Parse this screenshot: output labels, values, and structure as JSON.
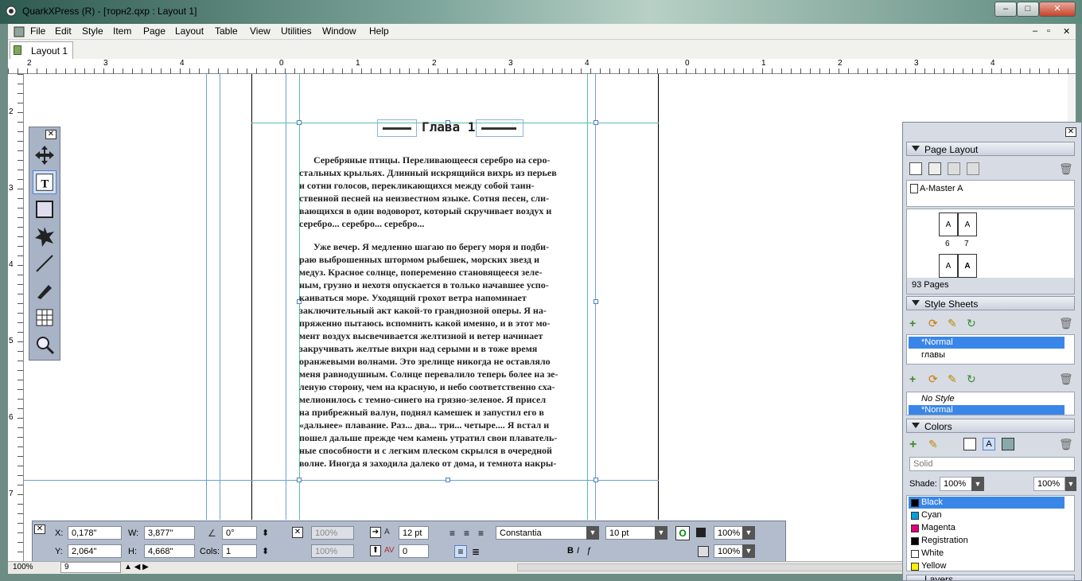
{
  "window": {
    "title": "QuarkXPress (R) - [торн2.qxp : Layout 1]",
    "controls": [
      "–",
      "□",
      "✕"
    ],
    "doc_controls": [
      "–",
      "▫",
      "✕"
    ]
  },
  "menu": [
    "File",
    "Edit",
    "Style",
    "Item",
    "Page",
    "Layout",
    "Table",
    "View",
    "Utilities",
    "Window",
    "Help"
  ],
  "tab": {
    "label": "Layout 1"
  },
  "ruler": {
    "h_ticks": [
      "2",
      "3",
      "4",
      "0",
      "1",
      "2",
      "3",
      "4",
      "0",
      "1",
      "2",
      "3",
      "4"
    ],
    "v_ticks": [
      "2",
      "3",
      "4",
      "5",
      "6",
      "7"
    ]
  },
  "document": {
    "heading": "Глава 1",
    "paragraph1": [
      "Серебряные птицы. Переливающееся серебро на серо-",
      "стальных крыльях. Длинный искрящийся вихрь из перьев",
      "и сотни голосов, перекликающихся между собой таин-",
      "ственной песней на неизвестном языке. Сотня песен, сли-",
      "вающихся в один водоворот, который скручивает воздух и",
      "серебро... серебро... серебро..."
    ],
    "paragraph2": [
      "Уже вечер. Я медленно шагаю по берегу моря и подби-",
      "раю выброшенных штормом рыбешек, морских звезд и",
      "медуз. Красное солнце, попеременно становящееся зеле-",
      "ным, грузно и нехотя опускается в только начавшее успо-",
      "каиваться море. Уходящий грохот ветра напоминает",
      "заключительный акт какой-то грандиозной оперы. Я на-",
      "пряженно пытаюсь вспомнить какой именно, и в этот мо-",
      "мент воздух высвечивается желтизной и ветер начинает",
      "закручивать желтые вихри над серыми и в тоже время",
      "оранжевыми волнами. Это зрелище никогда не оставляло",
      "меня равнодушным. Солнце перевалило теперь более на зе-",
      "леную сторону, чем на красную, и небо соответственно сха-",
      "мелионилось с темно-синего на грязно-зеленое. Я присел",
      "на прибрежный валун, поднял камешек и запустил его в",
      "«дальнее» плавание. Раз... два... три... четыре.... Я встал и",
      "пошел дальше прежде чем камень утратил свои плаватель-",
      "ные способности и с легким плеском скрылся в очередной",
      "волне. Иногда я заходила далеко от дома, и темнота накры-"
    ]
  },
  "measurements": {
    "x_label": "X:",
    "x_value": "0,178\"",
    "y_label": "Y:",
    "y_value": "2,064\"",
    "w_label": "W:",
    "w_value": "3,877\"",
    "h_label": "H:",
    "h_value": "4,668\"",
    "angle_value": "0°",
    "cols_label": "Cols:",
    "cols_value": "1",
    "shade1": "100%",
    "shade2": "100%",
    "leading": "12 pt",
    "tracking": "0",
    "font": "Constantia",
    "size": "10 pt",
    "color_shade": "100%",
    "color_shade2": "100%",
    "bold": "B",
    "italic": "I"
  },
  "status": {
    "zoom": "100%",
    "page": "9"
  },
  "palettes": {
    "page_layout": {
      "title": "Page Layout",
      "master": "A-Master A",
      "page_labels": [
        "A",
        "A",
        "A",
        "A"
      ],
      "page_numbers": [
        "6",
        "7"
      ],
      "count": "93 Pages"
    },
    "style_sheets": {
      "title": "Style Sheets",
      "para_styles": [
        "*Normal",
        "главы"
      ],
      "char_styles": [
        "No Style",
        "*Normal"
      ]
    },
    "colors": {
      "title": "Colors",
      "fill_mode": "Solid",
      "shade_label": "Shade:",
      "shade_value": "100%",
      "opacity_value": "100%",
      "items": [
        {
          "name": "Black",
          "color": "#000000"
        },
        {
          "name": "Cyan",
          "color": "#00a0e0"
        },
        {
          "name": "Magenta",
          "color": "#e0007a"
        },
        {
          "name": "Registration",
          "color": "#000000"
        },
        {
          "name": "White",
          "color": "#ffffff"
        },
        {
          "name": "Yellow",
          "color": "#ffef00"
        }
      ]
    },
    "layers": {
      "title": "Layers"
    }
  }
}
